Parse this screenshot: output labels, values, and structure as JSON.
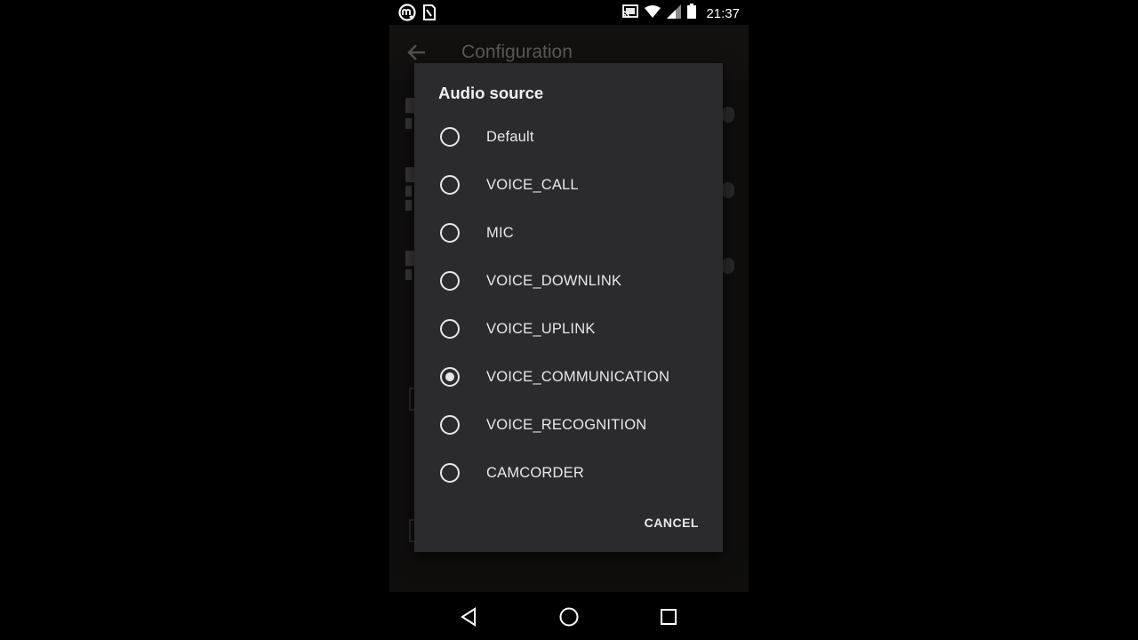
{
  "status_bar": {
    "time": "21:37",
    "left_icons": [
      "app-notification-icon",
      "sim-card-icon"
    ],
    "right_icons": [
      "cast-icon",
      "wifi-icon",
      "cell-signal-icon",
      "battery-icon"
    ]
  },
  "app_bar": {
    "title": "Configuration",
    "back_icon": "arrow-back-icon"
  },
  "dialog": {
    "title": "Audio source",
    "options": [
      {
        "label": "Default",
        "selected": false
      },
      {
        "label": "VOICE_CALL",
        "selected": false
      },
      {
        "label": "MIC",
        "selected": false
      },
      {
        "label": "VOICE_DOWNLINK",
        "selected": false
      },
      {
        "label": "VOICE_UPLINK",
        "selected": false
      },
      {
        "label": "VOICE_COMMUNICATION",
        "selected": true
      },
      {
        "label": "VOICE_RECOGNITION",
        "selected": false
      },
      {
        "label": "CAMCORDER",
        "selected": false
      }
    ],
    "cancel_label": "CANCEL"
  },
  "nav_bar": {
    "back_icon": "nav-back-icon",
    "home_icon": "nav-home-icon",
    "recents_icon": "nav-recents-icon"
  },
  "colors": {
    "dialog_bg": "#2b2b2f",
    "text": "#e8e8e8",
    "background": "#000000"
  }
}
